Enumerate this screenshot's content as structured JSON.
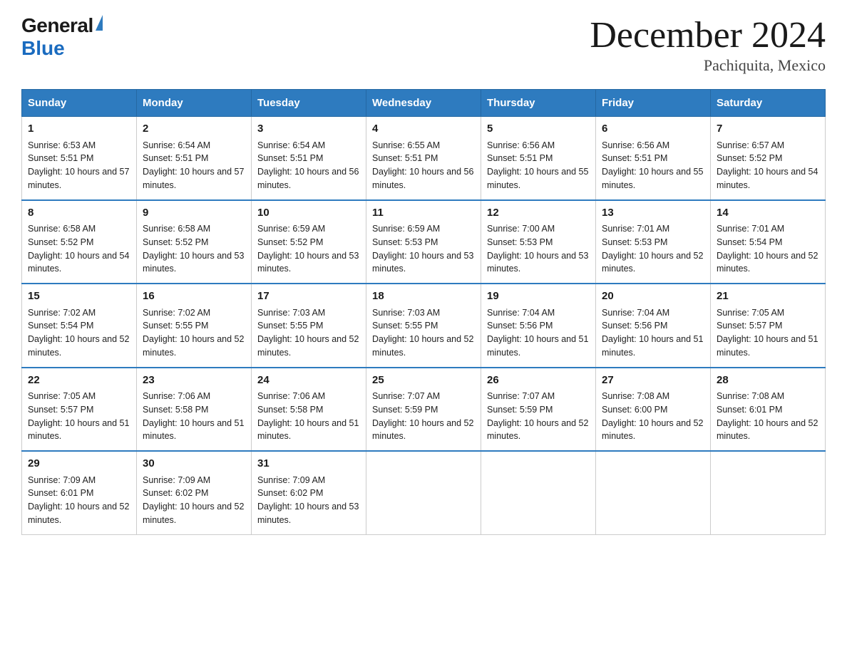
{
  "header": {
    "logo_general": "General",
    "logo_blue": "Blue",
    "month_title": "December 2024",
    "location": "Pachiquita, Mexico"
  },
  "weekdays": [
    "Sunday",
    "Monday",
    "Tuesday",
    "Wednesday",
    "Thursday",
    "Friday",
    "Saturday"
  ],
  "weeks": [
    [
      {
        "day": "1",
        "sunrise": "6:53 AM",
        "sunset": "5:51 PM",
        "daylight": "10 hours and 57 minutes."
      },
      {
        "day": "2",
        "sunrise": "6:54 AM",
        "sunset": "5:51 PM",
        "daylight": "10 hours and 57 minutes."
      },
      {
        "day": "3",
        "sunrise": "6:54 AM",
        "sunset": "5:51 PM",
        "daylight": "10 hours and 56 minutes."
      },
      {
        "day": "4",
        "sunrise": "6:55 AM",
        "sunset": "5:51 PM",
        "daylight": "10 hours and 56 minutes."
      },
      {
        "day": "5",
        "sunrise": "6:56 AM",
        "sunset": "5:51 PM",
        "daylight": "10 hours and 55 minutes."
      },
      {
        "day": "6",
        "sunrise": "6:56 AM",
        "sunset": "5:51 PM",
        "daylight": "10 hours and 55 minutes."
      },
      {
        "day": "7",
        "sunrise": "6:57 AM",
        "sunset": "5:52 PM",
        "daylight": "10 hours and 54 minutes."
      }
    ],
    [
      {
        "day": "8",
        "sunrise": "6:58 AM",
        "sunset": "5:52 PM",
        "daylight": "10 hours and 54 minutes."
      },
      {
        "day": "9",
        "sunrise": "6:58 AM",
        "sunset": "5:52 PM",
        "daylight": "10 hours and 53 minutes."
      },
      {
        "day": "10",
        "sunrise": "6:59 AM",
        "sunset": "5:52 PM",
        "daylight": "10 hours and 53 minutes."
      },
      {
        "day": "11",
        "sunrise": "6:59 AM",
        "sunset": "5:53 PM",
        "daylight": "10 hours and 53 minutes."
      },
      {
        "day": "12",
        "sunrise": "7:00 AM",
        "sunset": "5:53 PM",
        "daylight": "10 hours and 53 minutes."
      },
      {
        "day": "13",
        "sunrise": "7:01 AM",
        "sunset": "5:53 PM",
        "daylight": "10 hours and 52 minutes."
      },
      {
        "day": "14",
        "sunrise": "7:01 AM",
        "sunset": "5:54 PM",
        "daylight": "10 hours and 52 minutes."
      }
    ],
    [
      {
        "day": "15",
        "sunrise": "7:02 AM",
        "sunset": "5:54 PM",
        "daylight": "10 hours and 52 minutes."
      },
      {
        "day": "16",
        "sunrise": "7:02 AM",
        "sunset": "5:55 PM",
        "daylight": "10 hours and 52 minutes."
      },
      {
        "day": "17",
        "sunrise": "7:03 AM",
        "sunset": "5:55 PM",
        "daylight": "10 hours and 52 minutes."
      },
      {
        "day": "18",
        "sunrise": "7:03 AM",
        "sunset": "5:55 PM",
        "daylight": "10 hours and 52 minutes."
      },
      {
        "day": "19",
        "sunrise": "7:04 AM",
        "sunset": "5:56 PM",
        "daylight": "10 hours and 51 minutes."
      },
      {
        "day": "20",
        "sunrise": "7:04 AM",
        "sunset": "5:56 PM",
        "daylight": "10 hours and 51 minutes."
      },
      {
        "day": "21",
        "sunrise": "7:05 AM",
        "sunset": "5:57 PM",
        "daylight": "10 hours and 51 minutes."
      }
    ],
    [
      {
        "day": "22",
        "sunrise": "7:05 AM",
        "sunset": "5:57 PM",
        "daylight": "10 hours and 51 minutes."
      },
      {
        "day": "23",
        "sunrise": "7:06 AM",
        "sunset": "5:58 PM",
        "daylight": "10 hours and 51 minutes."
      },
      {
        "day": "24",
        "sunrise": "7:06 AM",
        "sunset": "5:58 PM",
        "daylight": "10 hours and 51 minutes."
      },
      {
        "day": "25",
        "sunrise": "7:07 AM",
        "sunset": "5:59 PM",
        "daylight": "10 hours and 52 minutes."
      },
      {
        "day": "26",
        "sunrise": "7:07 AM",
        "sunset": "5:59 PM",
        "daylight": "10 hours and 52 minutes."
      },
      {
        "day": "27",
        "sunrise": "7:08 AM",
        "sunset": "6:00 PM",
        "daylight": "10 hours and 52 minutes."
      },
      {
        "day": "28",
        "sunrise": "7:08 AM",
        "sunset": "6:01 PM",
        "daylight": "10 hours and 52 minutes."
      }
    ],
    [
      {
        "day": "29",
        "sunrise": "7:09 AM",
        "sunset": "6:01 PM",
        "daylight": "10 hours and 52 minutes."
      },
      {
        "day": "30",
        "sunrise": "7:09 AM",
        "sunset": "6:02 PM",
        "daylight": "10 hours and 52 minutes."
      },
      {
        "day": "31",
        "sunrise": "7:09 AM",
        "sunset": "6:02 PM",
        "daylight": "10 hours and 53 minutes."
      },
      null,
      null,
      null,
      null
    ]
  ]
}
